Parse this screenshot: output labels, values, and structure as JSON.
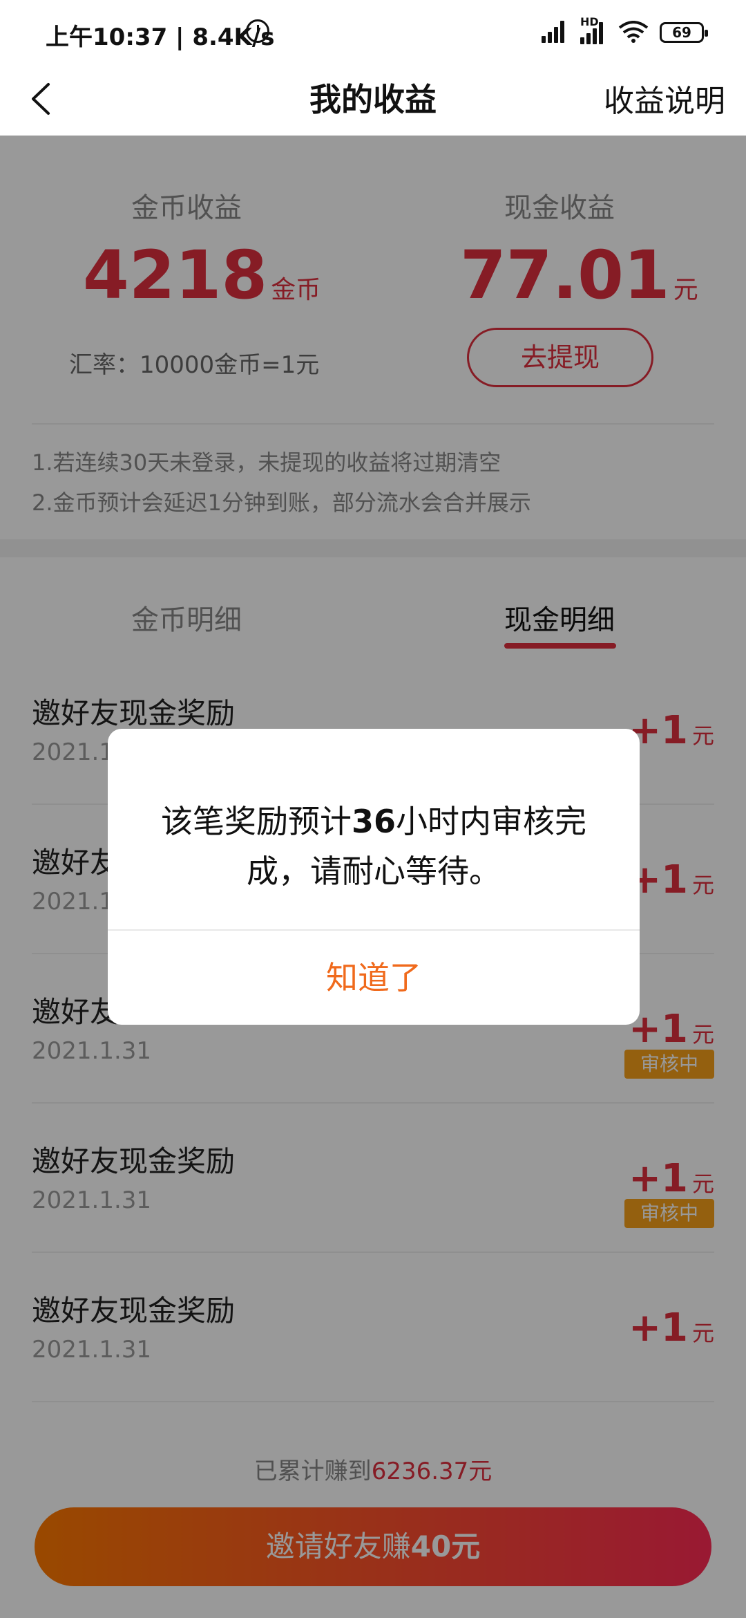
{
  "status_bar": {
    "time": "上午10:37 | 8.4K/s",
    "hd_label": "HD",
    "battery": "69"
  },
  "header": {
    "title": "我的收益",
    "explain_link": "收益说明"
  },
  "earnings": {
    "coin_label": "金币收益",
    "coin_value": "4218",
    "coin_unit": "金币",
    "cash_label": "现金收益",
    "cash_value": "77.01",
    "cash_unit": "元",
    "rate": "汇率：10000金币=1元",
    "withdraw_button": "去提现",
    "notes": [
      "1.若连续30天未登录，未提现的收益将过期清空",
      "2.金币预计会延迟1分钟到账，部分流水会合并展示"
    ]
  },
  "tabs": {
    "coin_detail": "金币明细",
    "cash_detail": "现金明细"
  },
  "rows": [
    {
      "title": "邀好友现金奖励",
      "date": "2021.1.31",
      "amount": "+1",
      "unit": "元",
      "badge": ""
    },
    {
      "title": "邀好友现金奖励",
      "date": "2021.1.31",
      "amount": "+1",
      "unit": "元",
      "badge": ""
    },
    {
      "title": "邀好友现金奖励",
      "date": "2021.1.31",
      "amount": "+1",
      "unit": "元",
      "badge": "审核中"
    },
    {
      "title": "邀好友现金奖励",
      "date": "2021.1.31",
      "amount": "+1",
      "unit": "元",
      "badge": "审核中"
    },
    {
      "title": "邀好友现金奖励",
      "date": "2021.1.31",
      "amount": "+1",
      "unit": "元",
      "badge": ""
    }
  ],
  "footer": {
    "total_prefix": "已累计赚到",
    "total_value": "6236.37元",
    "invite_prefix": "邀请好友赚",
    "invite_amount": "40元"
  },
  "dialog": {
    "msg_part1": "该笔奖励预计",
    "msg_hours": "36",
    "msg_part2": "小时内审核完",
    "msg_line2": "成，请耐心等待。",
    "ok_button": "知道了"
  },
  "colors": {
    "accent_red": "#e0303e",
    "badge_orange": "#f7a11a",
    "dialog_button": "#f06a1c"
  }
}
